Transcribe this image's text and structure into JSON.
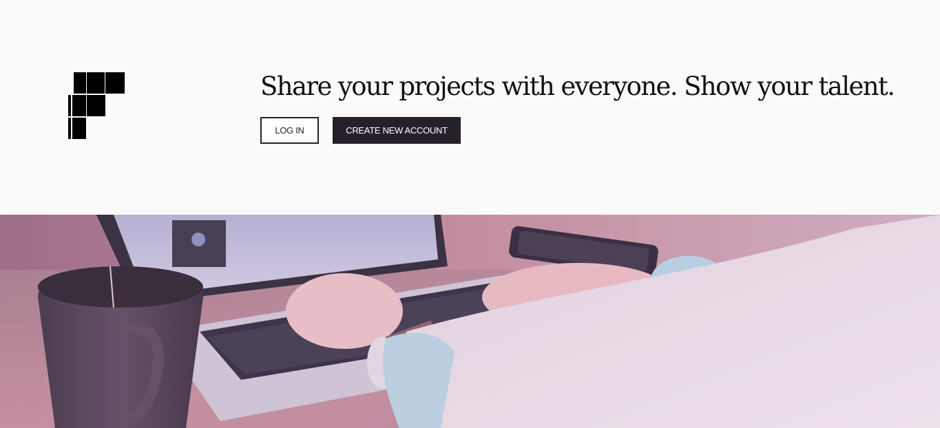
{
  "header": {
    "headline": "Share your projects with everyone. Show your talent.",
    "login_label": "LOG IN",
    "create_account_label": "CREATE NEW ACCOUNT"
  },
  "hero": {
    "icon": "photo-person-typing-on-laptop"
  },
  "colors": {
    "background": "#fafafa",
    "primary_dark": "#26202b",
    "headline_text": "#111111"
  }
}
